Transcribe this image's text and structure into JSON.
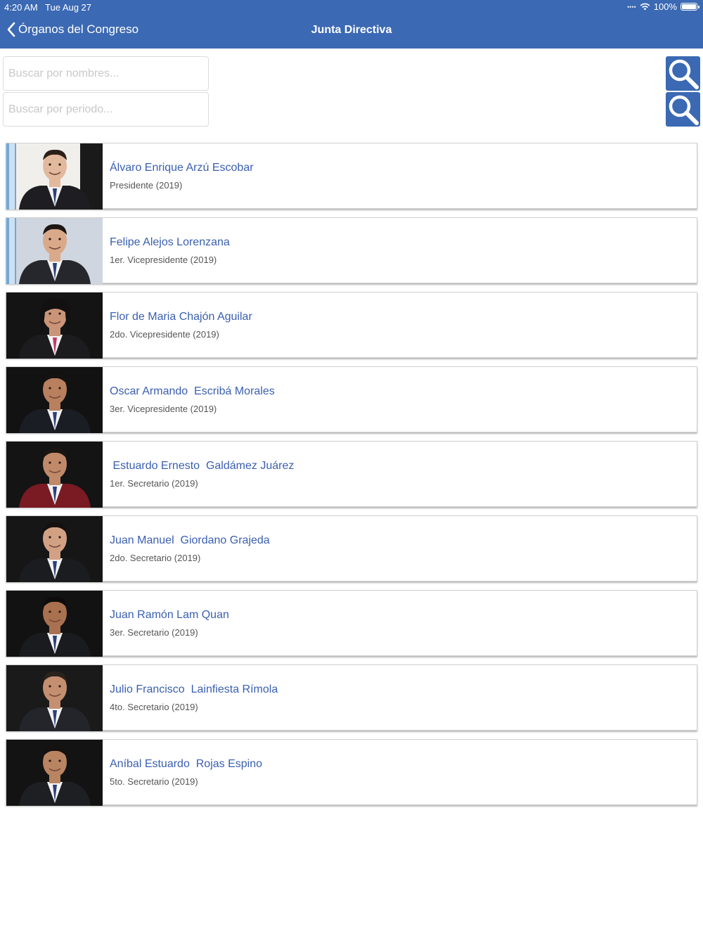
{
  "status_bar": {
    "time": "4:20 AM",
    "date": "Tue Aug 27",
    "battery": "100%"
  },
  "nav": {
    "back_label": "Órganos del Congreso",
    "title": "Junta Directiva"
  },
  "search": {
    "names_placeholder": "Buscar por nombres...",
    "period_placeholder": "Buscar por periodo..."
  },
  "members": [
    {
      "name": "Álvaro Enrique Arzú Escobar",
      "role": "Presidente (2019)"
    },
    {
      "name": "Felipe Alejos Lorenzana",
      "role": "1er. Vicepresidente (2019)"
    },
    {
      "name": "Flor de Maria Chajón Aguilar",
      "role": "2do. Vicepresidente (2019)"
    },
    {
      "name": "Oscar Armando  Escribá Morales",
      "role": "3er. Vicepresidente (2019)"
    },
    {
      "name": " Estuardo Ernesto  Galdámez Juárez",
      "role": "1er. Secretario (2019)"
    },
    {
      "name": "Juan Manuel  Giordano Grajeda",
      "role": "2do. Secretario (2019)"
    },
    {
      "name": "Juan Ramón Lam Quan",
      "role": "3er. Secretario (2019)"
    },
    {
      "name": "Julio Francisco  Lainfiesta Rímola",
      "role": "4to. Secretario (2019)"
    },
    {
      "name": "Aníbal Estuardo  Rojas Espino",
      "role": "5to. Secretario (2019)"
    }
  ],
  "colors": {
    "header": "#3b69b3",
    "link": "#3a5fb0"
  }
}
